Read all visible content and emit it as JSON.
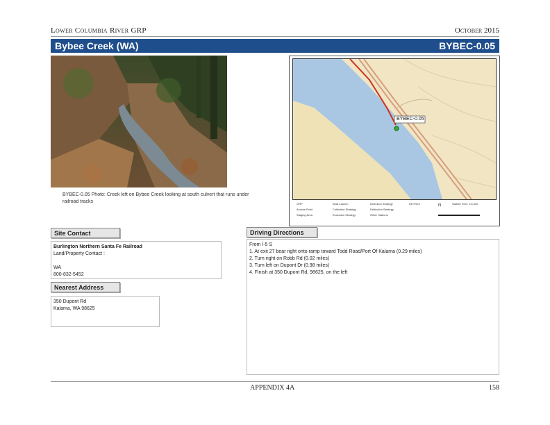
{
  "header": {
    "left": "Lower Columbia River GRP",
    "right": "October 2015"
  },
  "title": {
    "site_name": "Bybee Creek (WA)",
    "site_code": "BYBEC-0.05"
  },
  "photo": {
    "caption": "BYBEC-0.05 Photo: Creek left on Bybee Creek looking at south culvert that runs under railroad tracks"
  },
  "map": {
    "site_label": "BYBEC-0.05",
    "legend": {
      "items": [
        "GRP",
        "Access Point",
        "Staging Area",
        "Boat Launch",
        "Collection Strategy",
        "Exclusion Strategy",
        "Diversion Strategy",
        "Deflection Strategy",
        "Other Stations",
        "Kill Point"
      ],
      "north": "N",
      "scale_note": "Statute Feet, 1:6,000"
    },
    "colors": {
      "water": "#a9c7e3",
      "land": "#f1e5c3",
      "sand": "#efe2b7",
      "railroad": "#cc3322",
      "road": "#d69e7e"
    }
  },
  "site_contact": {
    "label": "Site Contact",
    "org": "Burlington Northern Santa Fe Railroad",
    "contact_line": "Land/Property Contact :",
    "state": "WA",
    "phone": "800-832-5452"
  },
  "nearest_address": {
    "label": "Nearest Address",
    "line1": "350 Dupont Rd",
    "line2": "Kalama, WA  98625"
  },
  "driving_directions": {
    "label": "Driving Directions",
    "lines": [
      "From I-5 S",
      "1. At exit 27 bear right onto ramp toward Todd Road/Port Of Kalama (0.29 miles)",
      "2. Turn right on Robb Rd (0.02 miles)",
      "3. Turn left on Dupont Dr (0.98 miles)",
      "4. Finish at 350 Dupont Rd, 98625, on the left"
    ]
  },
  "footer": {
    "center": "APPENDIX 4A",
    "page": "158"
  }
}
